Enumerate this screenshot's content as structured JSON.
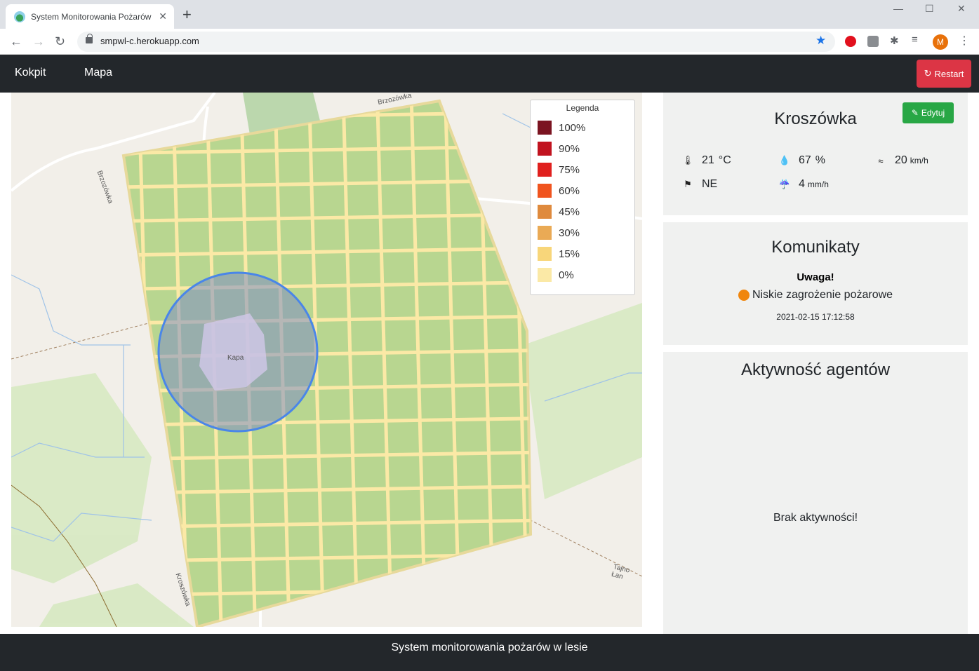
{
  "browser": {
    "tab_title": "System Monitorowania Pożarów",
    "url": "smpwl-c.herokuapp.com",
    "profile_initial": "M"
  },
  "navbar": {
    "links": [
      "Kokpit",
      "Mapa"
    ],
    "restart_label": "Restart"
  },
  "map": {
    "legend_title": "Legenda",
    "legend": [
      {
        "label": "100%",
        "color": "#7b1421"
      },
      {
        "label": "90%",
        "color": "#c1131f"
      },
      {
        "label": "75%",
        "color": "#e0201e"
      },
      {
        "label": "60%",
        "color": "#f0541f"
      },
      {
        "label": "45%",
        "color": "#df8a3d"
      },
      {
        "label": "30%",
        "color": "#eaaa55"
      },
      {
        "label": "15%",
        "color": "#f8d67a"
      },
      {
        "label": "0%",
        "color": "#fbe9a6"
      }
    ],
    "place_labels": [
      "Brzozówka",
      "Brzozówka",
      "Kapa",
      "Kroszówka",
      "Tajno Łan"
    ]
  },
  "weather": {
    "title": "Kroszówka",
    "edit_label": "Edytuj",
    "temperature": {
      "value": "21",
      "unit": "°C"
    },
    "humidity": {
      "value": "67",
      "unit": "%"
    },
    "wind_speed": {
      "value": "20",
      "unit": "km/h"
    },
    "wind_direction": "NE",
    "precipitation": {
      "value": "4",
      "unit": "mm/h"
    }
  },
  "messages": {
    "title": "Komunikaty",
    "heading": "Uwaga!",
    "text": "Niskie zagrożenie pożarowe",
    "level_color": "#f0860d",
    "timestamp": "2021-02-15 17:12:58"
  },
  "agents": {
    "title": "Aktywność agentów",
    "empty": "Brak aktywności!"
  },
  "footer": {
    "text": "System monitorowania pożarów w lesie"
  }
}
